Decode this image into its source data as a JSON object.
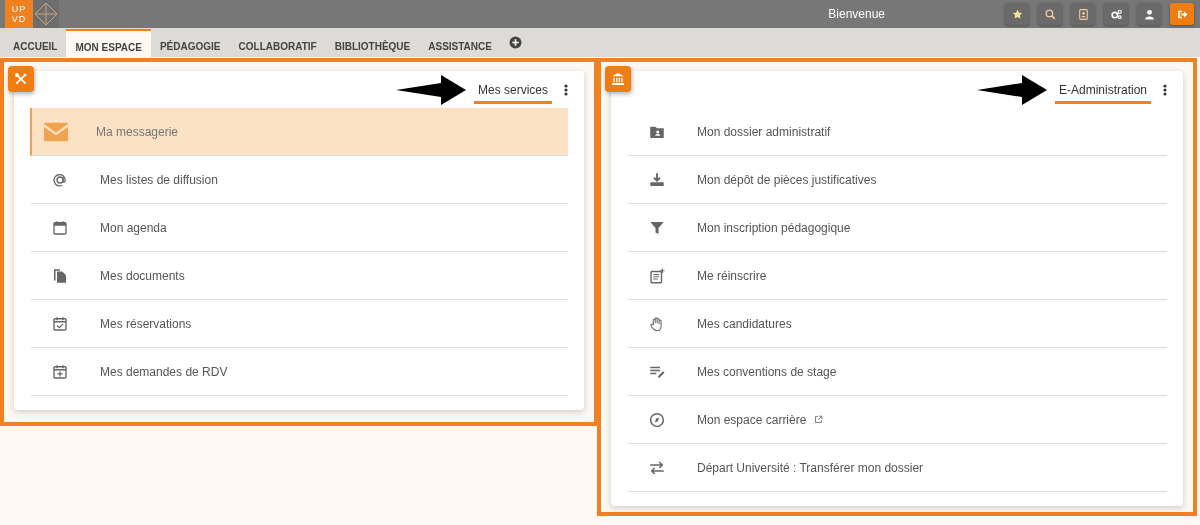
{
  "header": {
    "logo": {
      "line1": "UP",
      "line2": "VD"
    },
    "greeting": "Bienvenue"
  },
  "tabs": [
    {
      "label": "ACCUEIL",
      "selected": false
    },
    {
      "label": "MON ESPACE",
      "selected": true
    },
    {
      "label": "PÉDAGOGIE",
      "selected": false
    },
    {
      "label": "COLLABORATIF",
      "selected": false
    },
    {
      "label": "BIBLIOTHÈQUE",
      "selected": false
    },
    {
      "label": "ASSISTANCE",
      "selected": false
    }
  ],
  "panels": [
    {
      "title": "Mes services",
      "items": [
        {
          "label": "Ma messagerie",
          "selected": true
        },
        {
          "label": "Mes listes de diffusion",
          "selected": false
        },
        {
          "label": "Mon agenda",
          "selected": false
        },
        {
          "label": "Mes documents",
          "selected": false
        },
        {
          "label": "Mes réservations",
          "selected": false
        },
        {
          "label": "Mes demandes de RDV",
          "selected": false
        }
      ]
    },
    {
      "title": "E-Administration",
      "items": [
        {
          "label": "Mon dossier administratif",
          "selected": false
        },
        {
          "label": "Mon dépôt de pièces justificatives",
          "selected": false
        },
        {
          "label": "Mon inscription pédagogique",
          "selected": false
        },
        {
          "label": "Me réinscrire",
          "selected": false
        },
        {
          "label": "Mes candidatures",
          "selected": false
        },
        {
          "label": "Mes conventions de stage",
          "selected": false
        },
        {
          "label": "Mon espace carrière",
          "selected": false,
          "external": true
        },
        {
          "label": "Départ Université : Transférer mon dossier",
          "selected": false
        }
      ]
    }
  ]
}
